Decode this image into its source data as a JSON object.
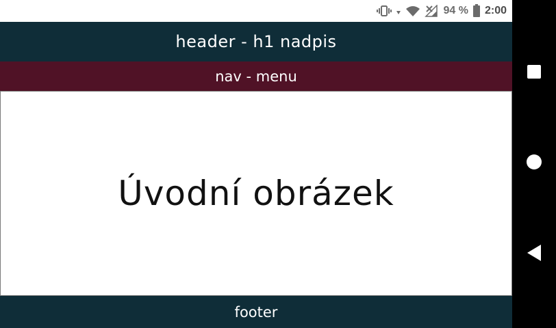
{
  "status_bar": {
    "battery_percent": "94 %",
    "time": "2:00",
    "icons": [
      "vibrate-icon",
      "wifi-icon",
      "cellular-signal-icon",
      "battery-icon"
    ]
  },
  "header": {
    "title": "header - h1 nadpis"
  },
  "nav": {
    "label": "nav - menu"
  },
  "hero": {
    "text": "Úvodní obrázek"
  },
  "footer": {
    "label": "footer"
  },
  "system_nav": {
    "buttons": [
      "recents-icon",
      "home-icon",
      "back-icon"
    ]
  },
  "colors": {
    "header_bg": "#0f2d38",
    "nav_bg": "#501226",
    "footer_bg": "#0f2d38",
    "system_nav_bg": "#000000"
  }
}
